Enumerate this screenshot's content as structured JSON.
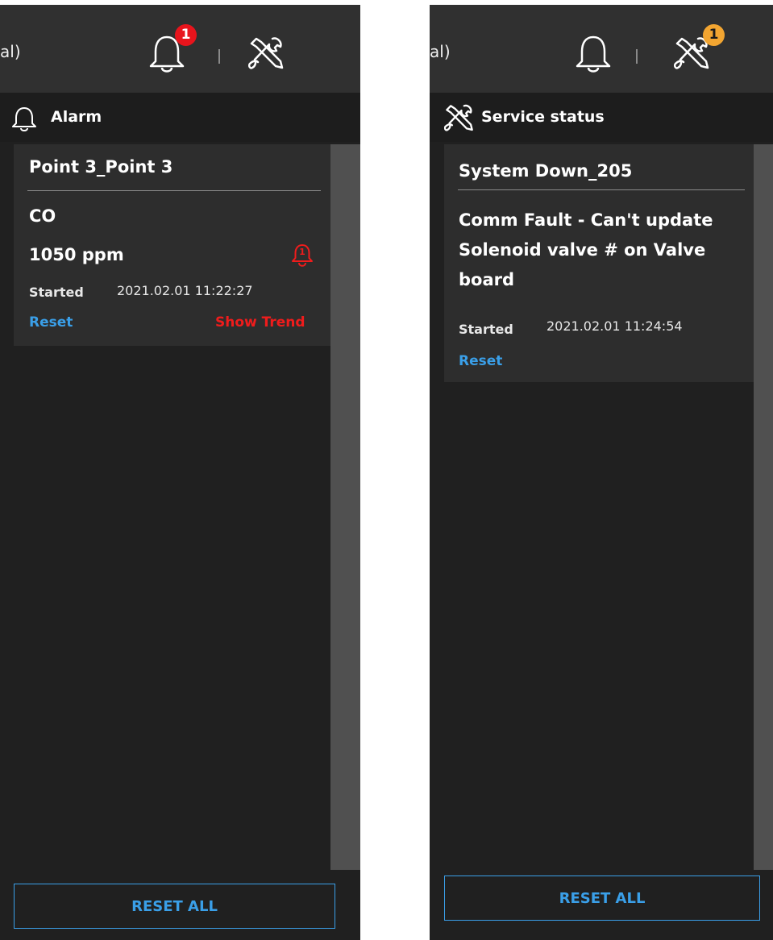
{
  "alarm_panel": {
    "topbar_text": "al)",
    "alarm_badge_count": "1",
    "header_title": "Alarm",
    "card": {
      "title": "Point 3_Point 3",
      "gas": "CO",
      "reading": "1050 ppm",
      "alarm_icon_count": "1",
      "started_label": "Started",
      "started_value": "2021.02.01 11:22:27",
      "reset_label": "Reset",
      "show_trend_label": "Show Trend"
    },
    "reset_all_label": "RESET ALL"
  },
  "service_panel": {
    "topbar_text": "al)",
    "service_badge_count": "1",
    "header_title": "Service status",
    "card": {
      "title": "System Down_205",
      "message": "Comm Fault - Can't update Solenoid valve # on Valve board",
      "started_label": "Started",
      "started_value": "2021.02.01 11:24:54",
      "reset_label": "Reset"
    },
    "reset_all_label": "RESET ALL"
  },
  "colors": {
    "alarm_red": "#ef1c1c",
    "service_amber": "#f2a531",
    "link_blue": "#3a9fe8",
    "panel_bg": "#202020",
    "topbar_bg": "#303030"
  },
  "icons": [
    "bell-icon",
    "tools-icon",
    "alarm-bell-icon"
  ]
}
